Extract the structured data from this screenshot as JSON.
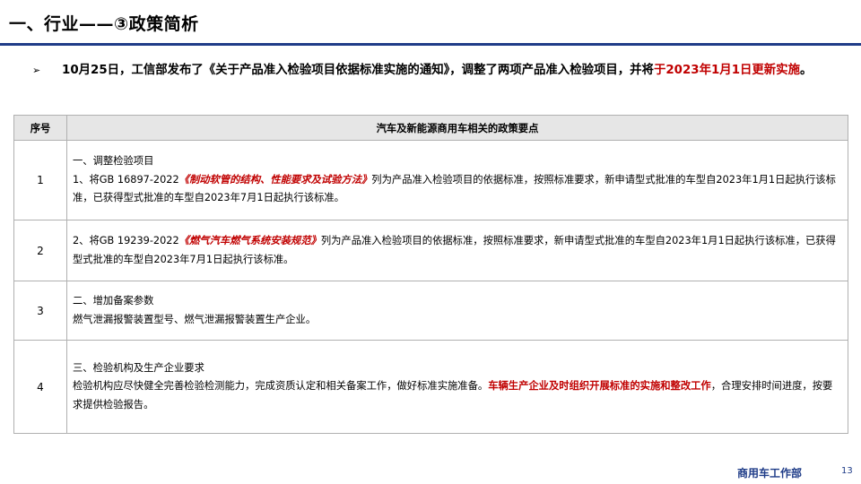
{
  "slide": {
    "title": "一、行业——③政策简析",
    "intro": {
      "bullet": "➢",
      "part1": "10月25日，工信部发布了《关于产品准入检验项目依据标准实施的通知》，调整了两项产品准入检验项目，并将",
      "part2_red": "于2023年1月1日更新实施",
      "part3": "。"
    },
    "table": {
      "headers": [
        "序号",
        "汽车及新能源商用车相关的政策要点"
      ],
      "rows": [
        {
          "no": "1",
          "heading": "一、调整检验项目",
          "pre": "1、将GB 16897-2022",
          "highlight": "《制动软管的结构、性能要求及试验方法》",
          "post": "列为产品准入检验项目的依据标准，按照标准要求，新申请型式批准的车型自2023年1月1日起执行该标准，已获得型式批准的车型自2023年7月1日起执行该标准。"
        },
        {
          "no": "2",
          "pre": "2、将GB 19239-2022",
          "highlight": "《燃气汽车燃气系统安装规范》",
          "post": "列为产品准入检验项目的依据标准，按照标准要求，新申请型式批准的车型自2023年1月1日起执行该标准，已获得型式批准的车型自2023年7月1日起执行该标准。"
        },
        {
          "no": "3",
          "heading": "二、增加备案参数",
          "body": "燃气泄漏报警装置型号、燃气泄漏报警装置生产企业。"
        },
        {
          "no": "4",
          "heading": "三、检验机构及生产企业要求",
          "pre": "检验机构应尽快健全完善检验检测能力，完成资质认定和相关备案工作，做好标准实施准备。",
          "highlight": "车辆生产企业及时组织开展标准的实施和整改工作",
          "post": "，合理安排时间进度，按要求提供检验报告。"
        }
      ]
    },
    "footer": {
      "department": "商用车工作部",
      "page": "13"
    },
    "colors": {
      "accent_blue": "#1f3c88",
      "highlight_red": "#c00000",
      "header_gray": "#e6e6e6"
    }
  }
}
